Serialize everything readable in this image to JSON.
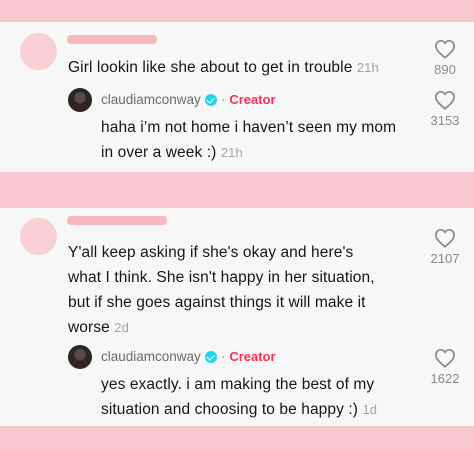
{
  "comments": [
    {
      "text": "Girl lookin like she about to get in trouble",
      "time": "21h",
      "likes": "890",
      "reply": {
        "username": "claudiamconway",
        "separator": "·",
        "badge": "Creator",
        "lines": [
          "haha i’m not home i haven’t seen my mom",
          "in over a week :)"
        ],
        "time": "21h",
        "likes": "3153"
      }
    },
    {
      "lines": [
        "Y'all keep asking if she's okay and here's",
        "what I think. She isn't happy in her situation,",
        "but if she goes against things it will make it",
        "worse"
      ],
      "time": "2d",
      "likes": "2107",
      "reply": {
        "username": "claudiamconway",
        "separator": "·",
        "badge": "Creator",
        "lines": [
          "yes exactly. i am making the best of my",
          "situation and choosing to be happy :)"
        ],
        "time": "1d",
        "likes": "1622"
      }
    }
  ],
  "colors": {
    "accent": "#fe2c55",
    "verified": "#20d5ec",
    "background": "#f8c9d0",
    "redaction": "#f6b7c0"
  },
  "icons": {
    "like": "heart-outline-icon",
    "verified": "verified-badge-icon"
  }
}
